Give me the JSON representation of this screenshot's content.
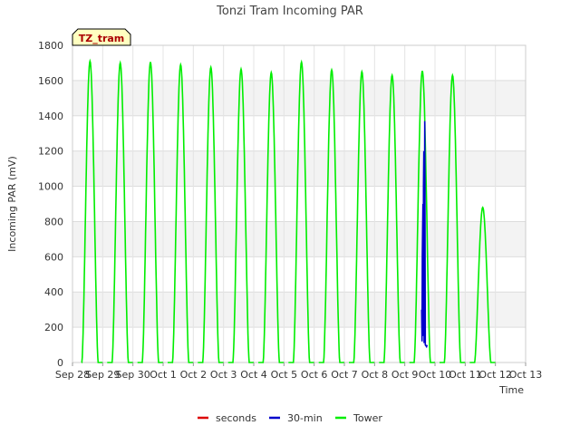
{
  "chart_data": {
    "type": "line",
    "title": "Tonzi Tram Incoming PAR",
    "xlabel": "Time",
    "ylabel": "Incoming PAR (mV)",
    "site_label": "TZ_tram",
    "ylim": [
      0,
      1800
    ],
    "yticks": [
      0,
      200,
      400,
      600,
      800,
      1000,
      1200,
      1400,
      1600,
      1800
    ],
    "xlim": [
      0,
      15
    ],
    "xtick_labels": [
      "Sep 28",
      "Sep 29",
      "Sep 30",
      "Oct 1",
      "Oct 2",
      "Oct 3",
      "Oct 4",
      "Oct 5",
      "Oct 6",
      "Oct 7",
      "Oct 8",
      "Oct 9",
      "Oct 10",
      "Oct 11",
      "Oct 12",
      "Oct 13"
    ],
    "grid": true,
    "legend_position": "bottom-center",
    "series": [
      {
        "name": "seconds",
        "color": "#dd0000",
        "days": []
      },
      {
        "name": "30-min",
        "color": "#0000cc",
        "days": [
          {
            "day": 11.56,
            "x": [
              11.56,
              11.57,
              11.58,
              11.6,
              11.61,
              11.62,
              11.63,
              11.64,
              11.66,
              11.68,
              11.7,
              11.72,
              11.74
            ],
            "y": [
              300,
              120,
              600,
              900,
              150,
              1000,
              1200,
              110,
              1370,
              100,
              95,
              90,
              100
            ]
          }
        ]
      },
      {
        "name": "Tower",
        "color": "#00ee00",
        "days": [
          {
            "day": 0,
            "peak": 1710
          },
          {
            "day": 1,
            "peak": 1700
          },
          {
            "day": 2,
            "peak": 1705
          },
          {
            "day": 3,
            "peak": 1690
          },
          {
            "day": 4,
            "peak": 1675
          },
          {
            "day": 5,
            "peak": 1665
          },
          {
            "day": 6,
            "peak": 1645
          },
          {
            "day": 7,
            "peak": 1705
          },
          {
            "day": 8,
            "peak": 1660
          },
          {
            "day": 9,
            "peak": 1650
          },
          {
            "day": 10,
            "peak": 1630
          },
          {
            "day": 11,
            "peak": 1655
          },
          {
            "day": 12,
            "peak": 1630
          },
          {
            "day": 13,
            "peak": 880
          }
        ]
      }
    ]
  }
}
